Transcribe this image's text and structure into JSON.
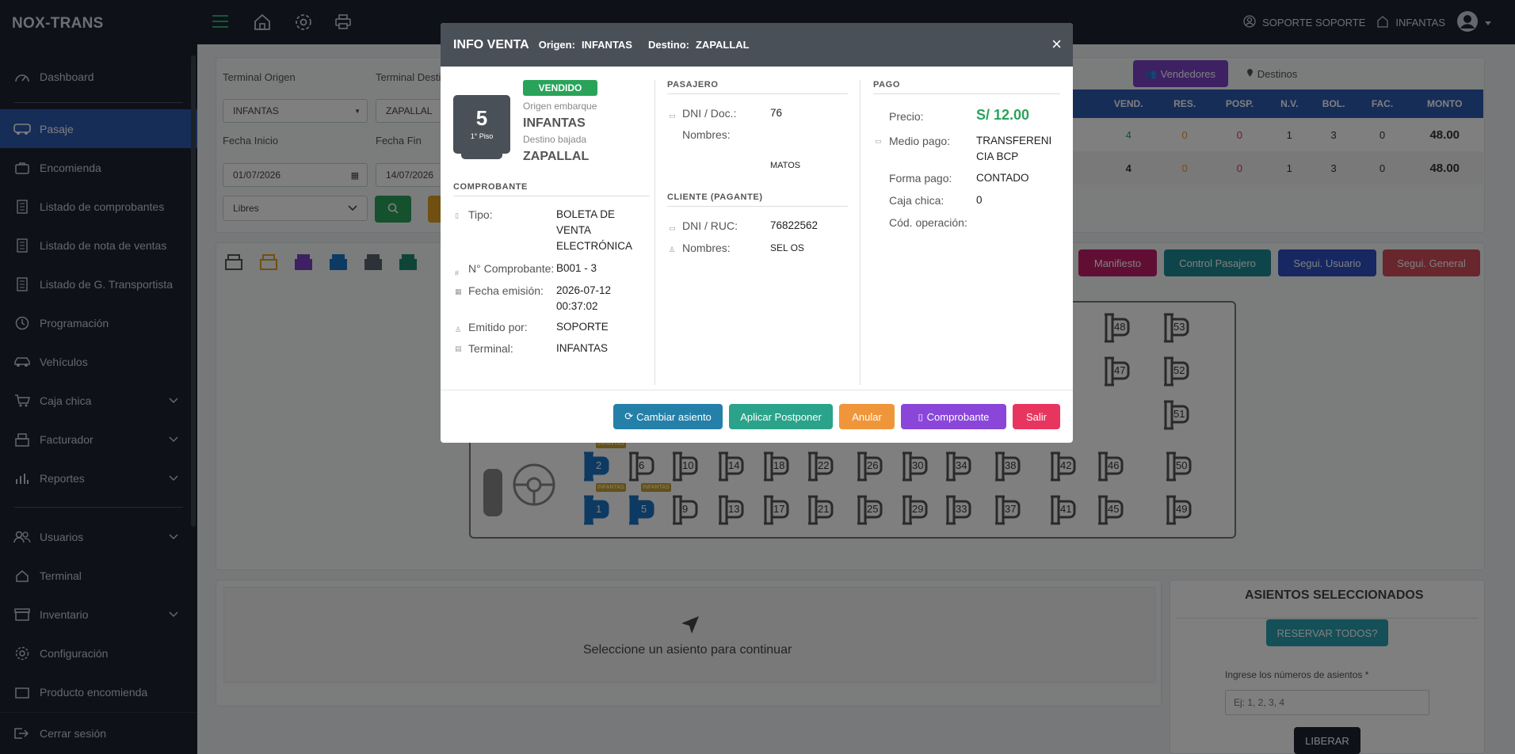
{
  "app": {
    "brand": "NOX-TRANS"
  },
  "sidebar": {
    "items": [
      {
        "label": "Dashboard",
        "icon": "gauge-icon"
      },
      {
        "label": "Pasaje",
        "icon": "bus-icon"
      },
      {
        "label": "Encomienda",
        "icon": "briefcase-icon"
      },
      {
        "label": "Listado de comprobantes",
        "icon": "receipt-icon"
      },
      {
        "label": "Listado de nota de ventas",
        "icon": "receipt-icon"
      },
      {
        "label": "Listado de G. Transportista",
        "icon": "receipt-icon"
      },
      {
        "label": "Programación",
        "icon": "clock-icon"
      },
      {
        "label": "Vehículos",
        "icon": "car-icon"
      },
      {
        "label": "Caja chica",
        "icon": "cart-icon"
      },
      {
        "label": "Facturador",
        "icon": "register-icon"
      },
      {
        "label": "Reportes",
        "icon": "bar-chart-icon"
      },
      {
        "label": "Usuarios",
        "icon": "users-icon"
      },
      {
        "label": "Terminal",
        "icon": "home-icon"
      },
      {
        "label": "Inventario",
        "icon": "archive-icon"
      },
      {
        "label": "Configuración",
        "icon": "gear-icon"
      },
      {
        "label": "Producto encomienda",
        "icon": "box-icon"
      }
    ],
    "logout": "Cerrar sesión"
  },
  "topbar": {
    "user": "SOPORTE SOPORTE",
    "terminal": "INFANTAS"
  },
  "filters": {
    "origin_label": "Terminal Origen",
    "origin_value": "INFANTAS",
    "dest_label": "Terminal Destino",
    "dest_value": "ZAPALLAL",
    "start_label": "Fecha Inicio",
    "start_value": "01/07/2026",
    "end_label": "Fecha Fin",
    "end_value": "14/07/2026",
    "seats_filter": "Libres"
  },
  "tabs": {
    "sellers": "Vendedores",
    "destinations": "Destinos"
  },
  "stats": {
    "headers": [
      "VEND.",
      "RES.",
      "POSP.",
      "N.V.",
      "BOL.",
      "FAC.",
      "MONTO"
    ],
    "rows": [
      [
        "4",
        "0",
        "0",
        "1",
        "3",
        "0",
        "48.00"
      ],
      [
        "4",
        "0",
        "0",
        "1",
        "3",
        "0",
        "48.00"
      ]
    ]
  },
  "actions": {
    "manifest": "Manifiesto",
    "control": "Control Pasajero",
    "user_track": "Segui. Usuario",
    "general_track": "Segui. General"
  },
  "bus": {
    "sold_tag": "INFANTAS",
    "seats": [
      "1",
      "2",
      "5",
      "6",
      "9",
      "10",
      "13",
      "14",
      "17",
      "18",
      "21",
      "22",
      "25",
      "26",
      "29",
      "30",
      "33",
      "34",
      "37",
      "38",
      "41",
      "42",
      "45",
      "46",
      "47",
      "48",
      "49",
      "50",
      "51",
      "52",
      "53"
    ]
  },
  "bottom": {
    "hint": "Seleccione un asiento para continuar"
  },
  "selected": {
    "title": "ASIENTOS SELECCIONADOS",
    "reserve_all": "RESERVAR TODOS?",
    "input_label": "Ingrese los números de asientos *",
    "input_placeholder": "Ej: 1, 2, 3, 4",
    "release": "LIBERAR"
  },
  "modal": {
    "title": "INFO VENTA",
    "origin_key": "Origen:",
    "origin": "INFANTAS",
    "dest_key": "Destino:",
    "dest": "ZAPALLAL",
    "seat_number": "5",
    "floor": "1° Piso",
    "status": "VENDIDO",
    "boarding_label": "Origen embarque",
    "boarding": "INFANTAS",
    "drop_label": "Destino bajada",
    "drop": "ZAPALLAL",
    "voucher": {
      "header": "COMPROBANTE",
      "type_k": "Tipo:",
      "type_v": "BOLETA DE VENTA ELECTRÓNICA",
      "number_k": "N° Comprobante:",
      "number_v": "B001 - 3",
      "date_k": "Fecha emisión:",
      "date_v": "2026-07-12 00:37:02",
      "issuer_k": "Emitido por:",
      "issuer_v": "SOPORTE",
      "terminal_k": "Terminal:",
      "terminal_v": "INFANTAS"
    },
    "passenger": {
      "header": "PASAJERO",
      "dni_k": "DNI / Doc.:",
      "dni_v": "76",
      "names_k": "Nombres:",
      "names_v": "MATOS"
    },
    "client": {
      "header": "CLIENTE (PAGANTE)",
      "ruc_k": "DNI / RUC:",
      "ruc_v": "76822562",
      "names_k": "Nombres:",
      "names_v": "SEL OS"
    },
    "payment": {
      "header": "PAGO",
      "price_k": "Precio:",
      "price_v": "S/ 12.00",
      "method_k": "Medio pago:",
      "method_v": "TRANSFERENICIA BCP",
      "form_k": "Forma pago:",
      "form_v": "CONTADO",
      "cash_k": "Caja chica:",
      "cash_v": "0",
      "op_k": "Cód. operación:"
    },
    "buttons": {
      "change": "Cambiar asiento",
      "postpone": "Aplicar Postponer",
      "cancel": "Anular",
      "voucher": "Comprobante",
      "exit": "Salir"
    }
  }
}
